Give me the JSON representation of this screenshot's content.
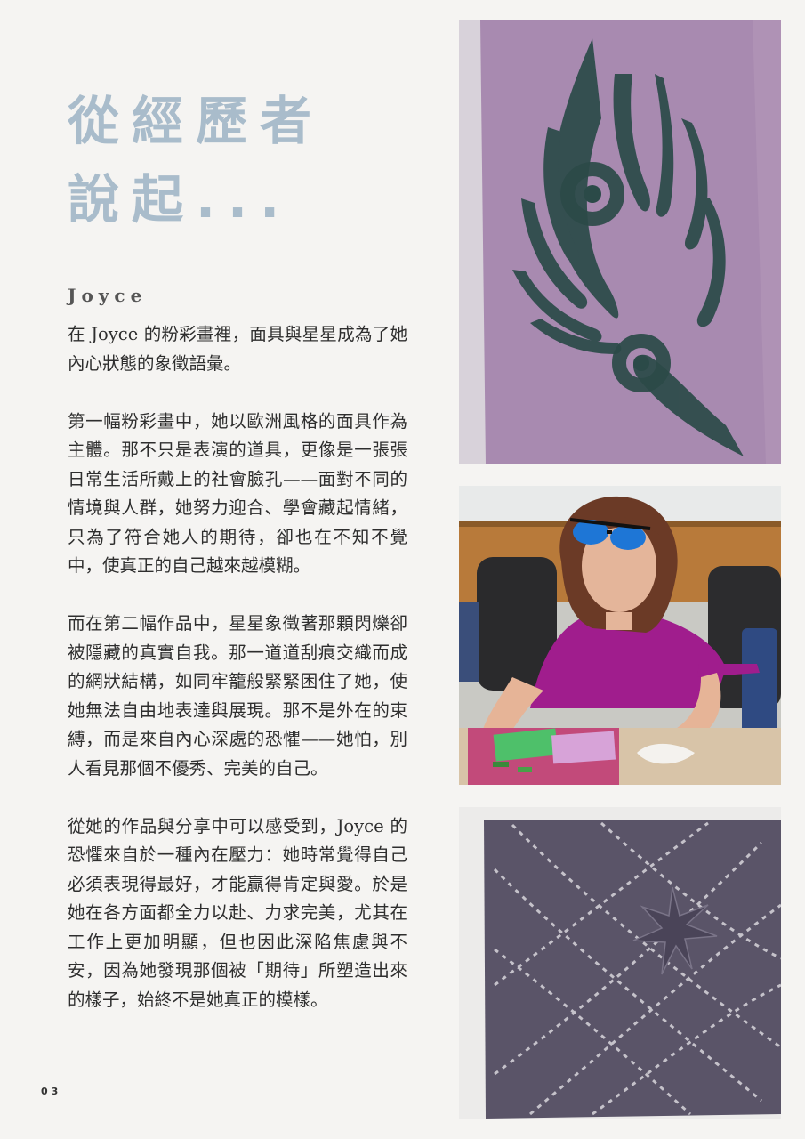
{
  "title": {
    "line1": "從經歷者",
    "line2": "說起..."
  },
  "author": "Joyce",
  "paragraphs": [
    "在 Joyce 的粉彩畫裡，面具與星星成為了她內心狀態的象徵語彙。",
    "第一幅粉彩畫中，她以歐洲風格的面具作為主體。那不只是表演的道具，更像是一張張日常生活所戴上的社會臉孔——面對不同的情境與人群，她努力迎合、學會藏起情緒，只為了符合她人的期待，卻也在不知不覺中，使真正的自己越來越模糊。",
    "而在第二幅作品中，星星象徵著那顆閃爍卻被隱藏的真實自我。那一道道刮痕交織而成的網狀結構，如同牢籠般緊緊困住了她，使她無法自由地表達與展現。那不是外在的束縛，而是來自內心深處的恐懼——她怕，別人看見那個不優秀、完美的自己。",
    "從她的作品與分享中可以感受到，Joyce 的恐懼來自於一種內在壓力：她時常覺得自己必須表現得最好，才能贏得肯定與愛。於是她在各方面都全力以赴、力求完美，尤其在工作上更加明顯，但也因此深陷焦慮與不安，因為她發現那個被「期待」所塑造出來的樣子，始終不是她真正的模樣。"
  ],
  "page_number": "03",
  "colors": {
    "title": "#a9bccb",
    "background": "#f5f4f2",
    "text": "#2e2e2e"
  }
}
